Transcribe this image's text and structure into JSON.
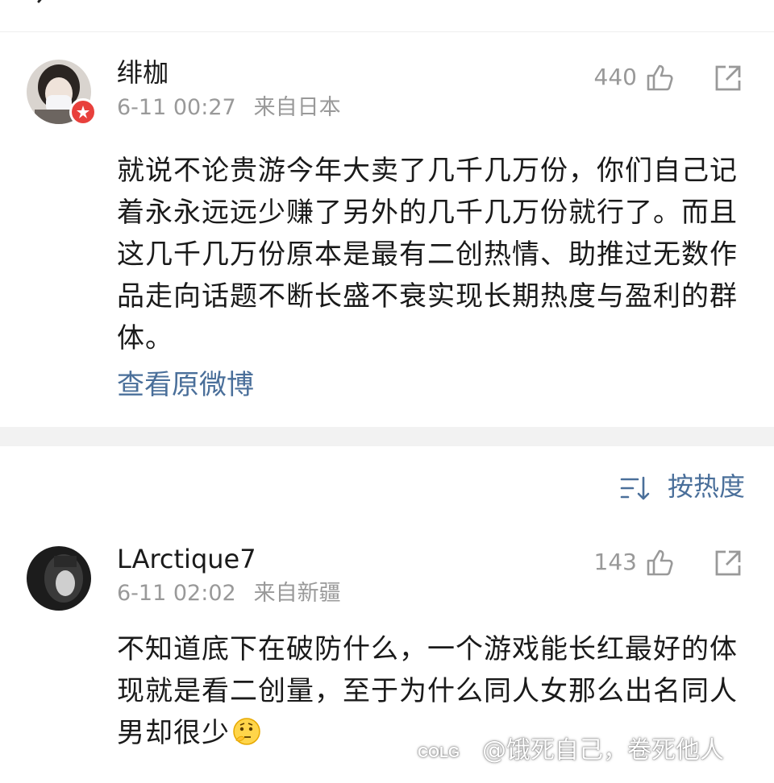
{
  "comments": [
    {
      "username": "绯枷",
      "date": "6-11 00:27",
      "source": "来自日本",
      "likes": "440",
      "body": "就说不论贵游今年大卖了几千几万份，你们自己记着永永远远少赚了另外的几千几万份就行了。而且这几千几万份原本是最有二创热情、助推过无数作品走向话题不断长盛不衰实现长期热度与盈利的群体。",
      "link": "查看原微博"
    },
    {
      "username": "LArctique7",
      "date": "6-11 02:02",
      "source": "来自新疆",
      "likes": "143",
      "body": "不知道底下在破防什么，一个游戏能长红最好的体现就是看二创量，至于为什么同人女那么出名同人男却很少"
    }
  ],
  "sort": {
    "label": "按热度"
  },
  "watermark": {
    "logo": "COLG",
    "text": "@饿死自己，卷死他人"
  },
  "colors": {
    "link": "#4a6f9a",
    "meta": "#999999",
    "badge": "#e8403c"
  },
  "icons": [
    "back-icon",
    "like-icon",
    "share-icon",
    "sort-icon",
    "verified-badge-icon",
    "thinking-emoji"
  ]
}
